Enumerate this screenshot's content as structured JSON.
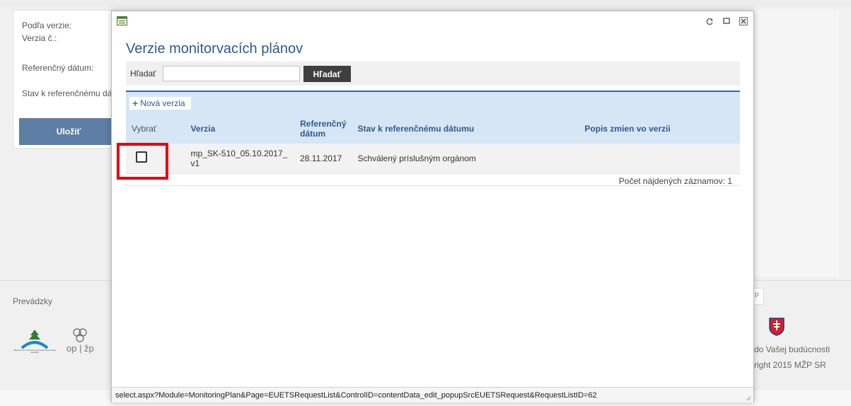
{
  "background_form": {
    "labels": [
      "Podľa verzie:",
      "Verzia č.:",
      "Referenčný dátum:",
      "Stav k referenčnému dá"
    ],
    "save_label": "Uložiť"
  },
  "footer": {
    "title": "Prevádzky",
    "tab_label": "p",
    "tagline": "do Vašej budúcnosti",
    "copyright": "right 2015 MŽP SR",
    "logo_op_text": "op | žp",
    "logo_small_text": "Ministerstvo životného prostredia Slovenskej republiky"
  },
  "modal": {
    "heading": "Verzie monitorvacích plánov",
    "search_label": "Hľadať",
    "search_value": "",
    "search_button": "Hľadať",
    "new_version_label": "Nová verzia",
    "columns": [
      "Vybrať",
      "Verzia",
      "Referenčný dátum",
      "Stav k referenčnému dátumu",
      "Popis zmien vo verzii"
    ],
    "rows": [
      {
        "version": "mp_SK-510_05.10.2017_v1",
        "ref_date": "28.11.2017",
        "status": "Schválený príslušným orgánom",
        "description": ""
      }
    ],
    "record_count": "Počet nájdených záznamov: 1",
    "status_url": "select.aspx?Module=MonitoringPlan&Page=EUETSRequestList&ControlID=contentData_edit_popupSrcEUETSRequest&RequestListID=62"
  },
  "colors": {
    "accent_blue": "#2d5b8e",
    "header_bg": "#d6e6f5",
    "highlight_red": "#e8000b",
    "save_button": "#5d7fa6"
  }
}
